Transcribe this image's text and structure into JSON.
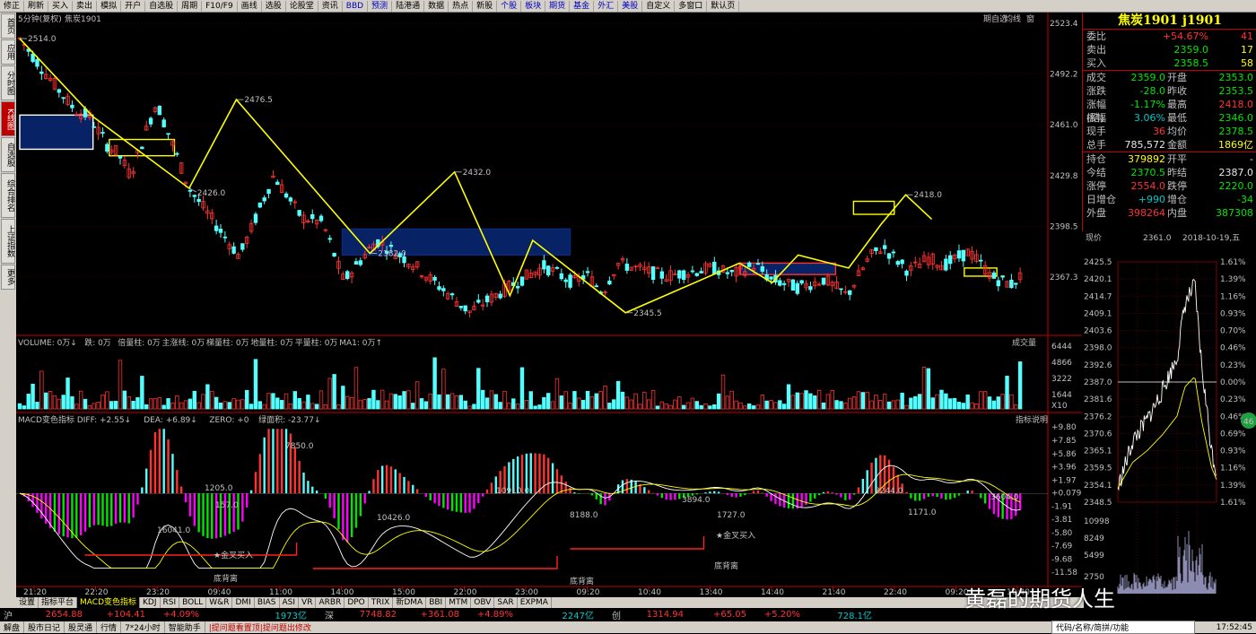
{
  "toolbar": {
    "items": [
      "修正",
      "刷新",
      "买入",
      "卖出",
      "模拟",
      "开户",
      "自选股",
      "周期",
      "F10/F9",
      "画线",
      "选股",
      "论股堂",
      "资讯",
      "BBD",
      "预测",
      "陆港通",
      "数据",
      "热点",
      "新股",
      "个股",
      "板块",
      "期货",
      "基金",
      "外汇",
      "美股",
      "自定义",
      "多窗口",
      "默认页"
    ]
  },
  "leftnav": {
    "items": [
      "首页",
      "应用",
      "分时图",
      "K线图",
      "自选股",
      "综合排名",
      "上证指数",
      "更多"
    ],
    "active": "K线图"
  },
  "chart_header": {
    "period": "5分钟(复权)",
    "symbol": "焦炭1901",
    "buttons": [
      "期自选",
      "均线",
      "窗"
    ]
  },
  "price_axis": [
    "2523.4",
    "2492.2",
    "2461.0",
    "2429.8",
    "2398.5",
    "2367.3"
  ],
  "annotations": {
    "high1": "2514.0",
    "p2476": "2476.5",
    "p2426": "2426.0",
    "p2432": "2432.0",
    "p2382": "2382.0",
    "p2345": "2345.5",
    "p2418": "2418.0"
  },
  "volume_header": {
    "title": "VOLUME",
    "items": [
      "VOLUME: 0万↓",
      "跌: 0万",
      "倍量柱: 0万",
      "主涨线: 0万",
      "梯量柱: 0万",
      "地量柱: 0万",
      "平量柱: 0万",
      "MA1: 0万↑"
    ],
    "selector": "成交量"
  },
  "volume_axis": [
    "6444",
    "4866",
    "3222",
    "1644",
    "X10"
  ],
  "macd_header": {
    "items": [
      "MACD变色指标  DIFF: +2.55↓",
      "DEA: +6.89↓",
      "ZERO: +0",
      "绿面积: -23.77↓"
    ],
    "button": "指标说明"
  },
  "macd_axis": [
    "+9.80",
    "+7.85",
    "+5.86",
    "+3.96",
    "+1.97",
    "+0.079",
    "-1.91",
    "-3.81",
    "-5.80",
    "-7.69",
    "-9.68",
    "-11.58"
  ],
  "macd_labels": {
    "a1": "7850.0",
    "a2": "1205.0",
    "a3": "157.0",
    "a4": "16041.0",
    "a5": "10910.0",
    "a6": "10426.0",
    "a7": "8188.0",
    "a8": "3894.0",
    "a9": "1727.0",
    "a10": "8244.0",
    "a11": "3604.0",
    "a12": "1171.0",
    "gold1": "★金叉买入",
    "gold2": "★金叉买入",
    "div1": "底背离",
    "div2": "底背离",
    "div3": "底背离"
  },
  "time_axis": [
    "21:20",
    "22:20",
    "23:20",
    "09:40",
    "11:00",
    "14:00",
    "15:00",
    "22:00",
    "23:00",
    "09:20",
    "10:40",
    "13:40",
    "14:40",
    "21:40",
    "22:40",
    "09:20",
    "10:40"
  ],
  "tabs": {
    "items": [
      "设置",
      "指标平台",
      "MACD变色指标",
      "KDJ",
      "RSI",
      "BOLL",
      "W&R",
      "DMI",
      "BIAS",
      "ASI",
      "VR",
      "ARBR",
      "DPO",
      "TRIX",
      "新DMA",
      "BBI",
      "MTM",
      "OBV",
      "SAR",
      "EXPMA"
    ],
    "active": "MACD变色指标"
  },
  "quote": {
    "title": "焦炭1901 j1901",
    "rows_top": [
      {
        "k": "委比",
        "v": "+54.67%",
        "n": "41",
        "vc": "red",
        "nc": "red"
      },
      {
        "k": "卖出",
        "v": "2359.0",
        "n": "17",
        "vc": "green",
        "nc": "yellow"
      },
      {
        "k": "买入",
        "v": "2358.5",
        "n": "58",
        "vc": "green",
        "nc": "yellow"
      }
    ],
    "rows_mid": [
      {
        "k1": "成交",
        "v1": "2359.0",
        "c1": "green",
        "k2": "开盘",
        "v2": "2353.0",
        "c2": "green"
      },
      {
        "k1": "涨跌",
        "v1": "-28.0",
        "c1": "green",
        "k2": "昨收",
        "v2": "2353.5",
        "c2": "green"
      },
      {
        "k1": "涨幅(结)",
        "v1": "-1.17%",
        "c1": "green",
        "k2": "最高",
        "v2": "2418.0",
        "c2": "red"
      },
      {
        "k1": "振幅",
        "v1": "3.06%",
        "c1": "cyan",
        "k2": "最低",
        "v2": "2346.0",
        "c2": "green"
      },
      {
        "k1": "现手",
        "v1": "36",
        "c1": "red",
        "k2": "均价",
        "v2": "2378.5",
        "c2": "green"
      },
      {
        "k1": "总手",
        "v1": "785,572",
        "c1": "white",
        "k2": "金额",
        "v2": "1869亿",
        "c2": "yellow"
      }
    ],
    "rows_bottom": [
      {
        "k1": "持仓",
        "v1": "379892",
        "c1": "yellow",
        "k2": "开平",
        "v2": "-",
        "c2": "white"
      },
      {
        "k1": "今结",
        "v1": "2370.5",
        "c1": "green",
        "k2": "昨结",
        "v2": "2387.0",
        "c2": "white"
      },
      {
        "k1": "涨停",
        "v1": "2554.0",
        "c1": "red",
        "k2": "跌停",
        "v2": "2220.0",
        "c2": "green"
      },
      {
        "k1": "日增仓",
        "v1": "+990",
        "c1": "cyan",
        "k2": "增仓",
        "v2": "-34",
        "c2": "green"
      },
      {
        "k1": "外盘",
        "v1": "398264",
        "c1": "red",
        "k2": "内盘",
        "v2": "387308",
        "c2": "green"
      }
    ]
  },
  "minichart": {
    "label": "现价",
    "price": "2361.0",
    "date": "2018-10-19,五",
    "left_axis": [
      "2425.5",
      "2420.1",
      "2414.7",
      "2409.1",
      "2403.6",
      "2398.0",
      "2392.6",
      "2387.0",
      "2381.6",
      "2376.2",
      "2370.6",
      "2365.1",
      "2359.5",
      "2354.1",
      "2348.5"
    ],
    "right_axis": [
      "1.61%",
      "1.39%",
      "1.16%",
      "0.93%",
      "0.70%",
      "0.46%",
      "0.23%",
      "0.00%",
      "0.23%",
      "0.46%",
      "0.69%",
      "0.93%",
      "1.16%",
      "1.39%",
      "1.61%"
    ],
    "vol_axis": [
      "10998",
      "8249",
      "5499",
      "2750"
    ],
    "badge": "46"
  },
  "indexbar": {
    "sh_label": "沪",
    "sh_value": "2654.88",
    "sh_change": "+104.41",
    "sh_pct": "+4.09%",
    "sh_amount": "1973亿",
    "sz_label": "深",
    "sz_value": "7748.82",
    "sz_change": "+361.08",
    "sz_pct": "+4.89%",
    "sz_amount": "2247亿",
    "cy_label": "创",
    "cy_value": "1314.94",
    "cy_change": "+65.05",
    "cy_pct": "+5.20%",
    "cy_amount": "728.1亿"
  },
  "statusbar": {
    "items": [
      "解盘",
      "股市日记",
      "股灵通",
      "行情",
      "7*24小时",
      "智能助手"
    ],
    "alert": "|提问题看置顶|提问题出修改",
    "search": "代码/名称/简拼/功能",
    "time": "17:52:45"
  },
  "watermark": "黄磊的期货人生"
}
